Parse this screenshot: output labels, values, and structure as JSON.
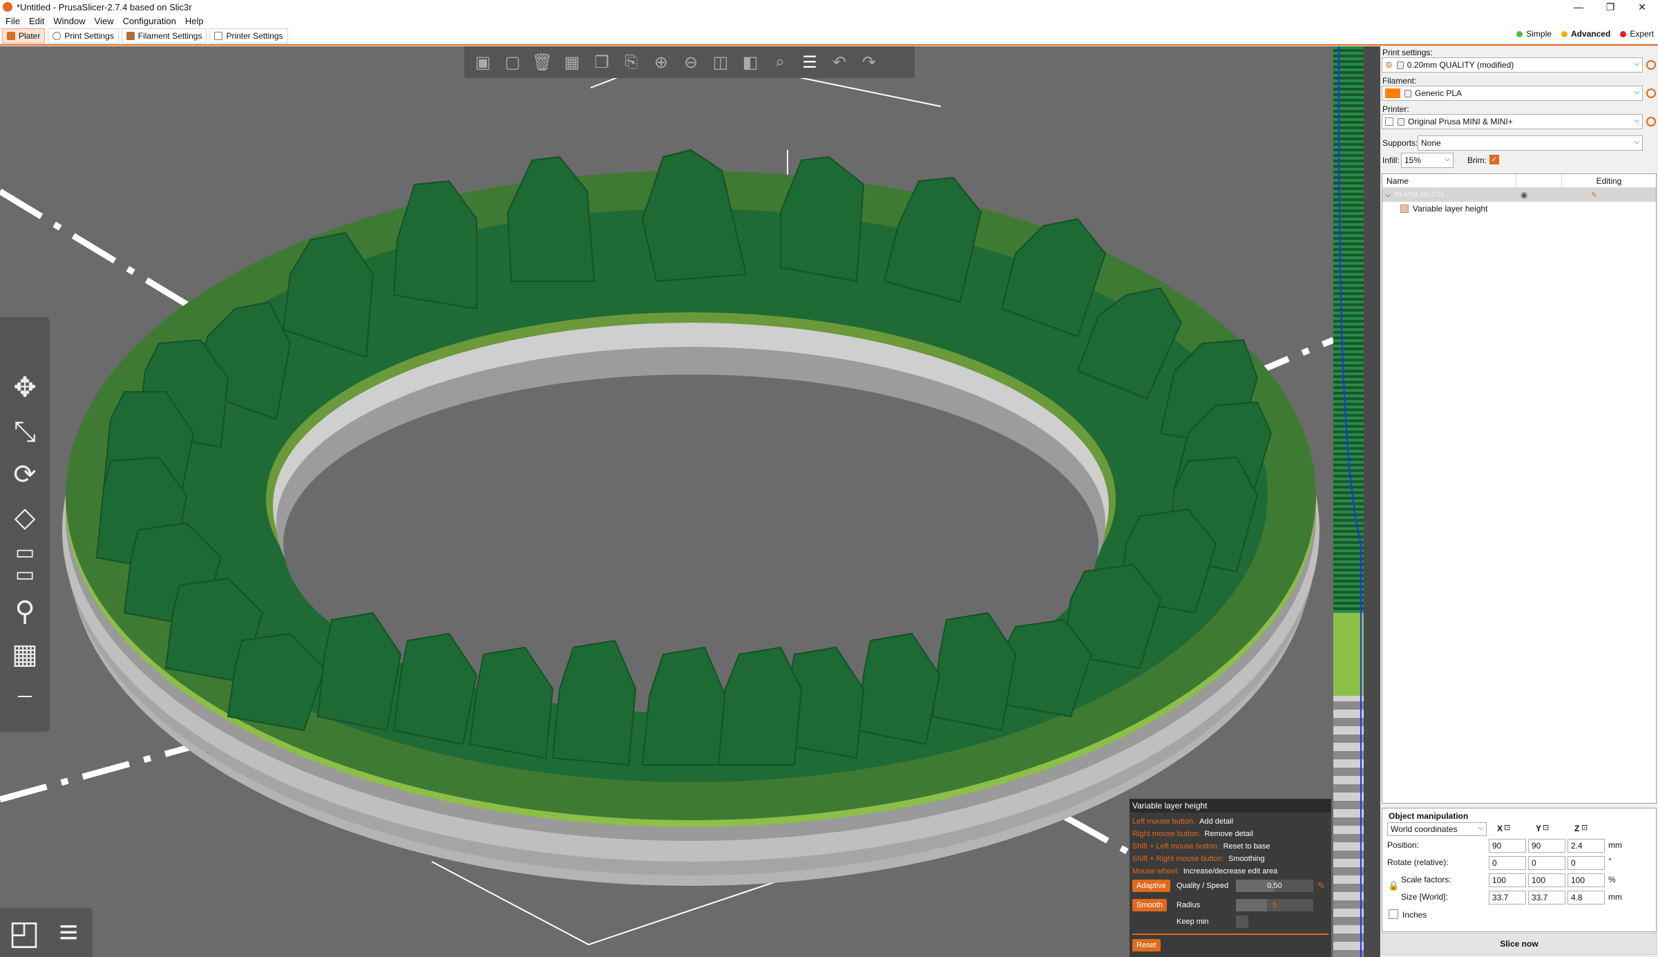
{
  "window": {
    "title": "*Untitled - PrusaSlicer-2.7.4 based on Slic3r",
    "minimize_glyph": "—",
    "maximize_glyph": "❐",
    "close_glyph": "✕"
  },
  "menu": [
    "File",
    "Edit",
    "Window",
    "View",
    "Configuration",
    "Help"
  ],
  "tabs": [
    "Plater",
    "Print Settings",
    "Filament Settings",
    "Printer Settings"
  ],
  "modes": [
    {
      "label": "Simple",
      "color": "#4fbf3f"
    },
    {
      "label": "Advanced",
      "color": "#f0b400"
    },
    {
      "label": "Expert",
      "color": "#e0201b"
    }
  ],
  "toolbar_icons": [
    "add-icon",
    "delete-icon",
    "delete-all-icon",
    "arrange-icon",
    "copy-icon",
    "paste-icon",
    "add-instance-icon",
    "remove-instance-icon",
    "split-objects-icon",
    "split-parts-icon",
    "search-icon",
    "layer-editing-icon",
    "undo-icon",
    "redo-icon"
  ],
  "toolbar_glyphs": [
    "▣",
    "▢",
    "🗑",
    "▦",
    "❐",
    "⎘",
    "⊕",
    "⊖",
    "◫",
    "◧",
    "⌕",
    "☰",
    "↶",
    "↷"
  ],
  "left_tools": [
    "move-icon",
    "scale-icon",
    "rotate-icon",
    "place-on-face-icon",
    "cut-icon",
    "supports-paint-icon",
    "seam-paint-icon",
    "measure-icon"
  ],
  "left_tool_glyphs": [
    "✥",
    "⤡",
    "⟳",
    "◇",
    "▭",
    "▭",
    "⚲",
    "▦",
    "⎯"
  ],
  "view_button_glyphs": [
    "◰",
    "≡"
  ],
  "print_settings": {
    "label": "Print settings:",
    "value": "0.20mm QUALITY (modified)"
  },
  "filament": {
    "label": "Filament:",
    "value": "Generic PLA",
    "color": "#ff8000"
  },
  "printer": {
    "label": "Printer:",
    "value": "Original Prusa MINI & MINI+"
  },
  "supports": {
    "label": "Supports:",
    "value": "None"
  },
  "infill": {
    "label": "Infill:",
    "value": "15%"
  },
  "brim": {
    "label": "Brim:",
    "checked": true
  },
  "object_list": {
    "col_name": "Name",
    "col_editing": "Editing",
    "object_name": "PI-P04-00.STL",
    "child": "Variable layer height"
  },
  "object_manipulation": {
    "title": "Object manipulation",
    "coord_system": "World coordinates",
    "axes": [
      "X",
      "Y",
      "Z"
    ],
    "position_label": "Position:",
    "position": [
      "90",
      "90",
      "2.4"
    ],
    "position_unit": "mm",
    "rotate_label": "Rotate (relative):",
    "rotate": [
      "0",
      "0",
      "0"
    ],
    "rotate_unit": "°",
    "scale_label": "Scale factors:",
    "scale": [
      "100",
      "100",
      "100"
    ],
    "scale_unit": "%",
    "size_label": "Size [World]:",
    "size": [
      "33.7",
      "33.7",
      "4.8"
    ],
    "size_unit": "mm",
    "inches_label": "Inches"
  },
  "slice_button": "Slice now",
  "variable_layer": {
    "title": "Variable layer height",
    "help": [
      {
        "key": "Left mouse button:",
        "desc": "Add detail"
      },
      {
        "key": "Right mouse button:",
        "desc": "Remove detail"
      },
      {
        "key": "Shift + Left mouse button:",
        "desc": "Reset to base"
      },
      {
        "key": "Shift + Right mouse button:",
        "desc": "Smoothing"
      },
      {
        "key": "Mouse wheel:",
        "desc": "Increase/decrease edit area"
      }
    ],
    "adaptive_button": "Adaptive",
    "quality_label": "Quality / Speed",
    "quality_value": "0.50",
    "quality_fraction": 0.5,
    "smooth_button": "Smooth",
    "radius_label": "Radius",
    "radius_value": "5",
    "radius_fraction": 0.4,
    "keep_min_label": "Keep min",
    "reset_button": "Reset"
  },
  "colors": {
    "accent": "#e06a1b",
    "model_green": "#1f6b36",
    "viewport_bg": "#6b6b6b"
  }
}
